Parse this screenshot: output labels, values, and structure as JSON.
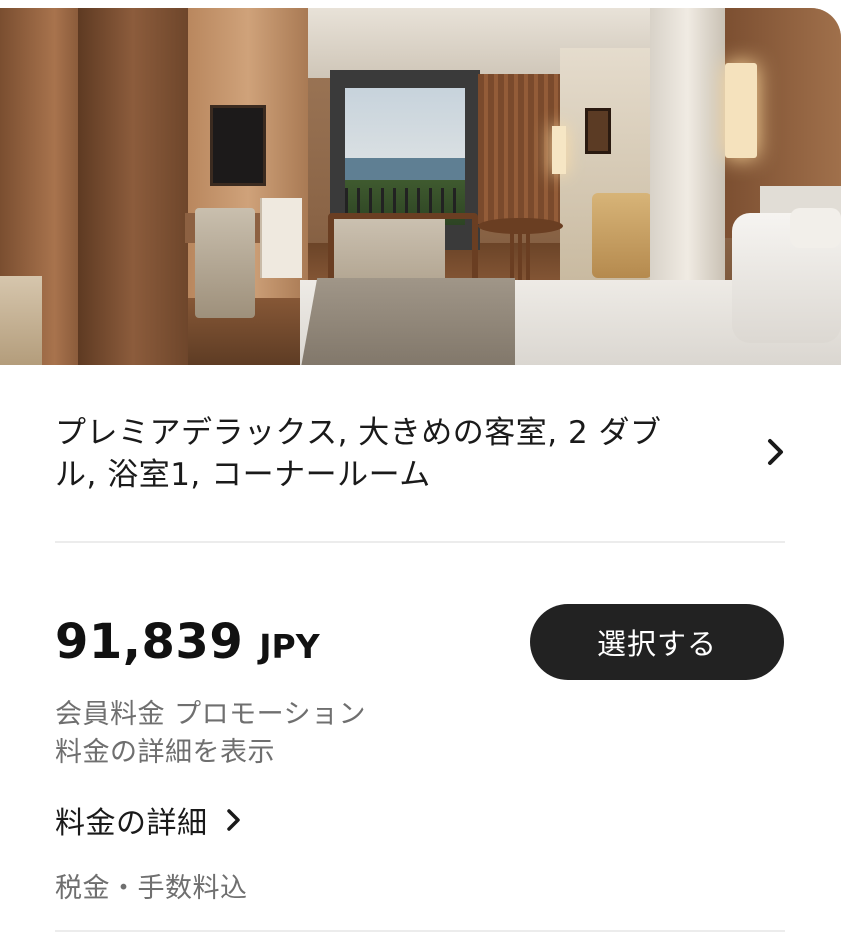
{
  "room": {
    "image_alt": "客室の写真",
    "title": "プレミアデラックス, 大きめの客室, 2 ダブル, 浴室1, コーナールーム",
    "title_chevron_icon": "chevron-right-icon"
  },
  "pricing": {
    "amount": "91,839",
    "currency": "JPY",
    "select_label": "選択する",
    "rate_type": "会員料金 プロモーション",
    "rate_detail_link": "料金の詳細を表示",
    "price_detail_label": "料金の詳細",
    "price_detail_icon": "chevron-right-icon",
    "tax_note": "税金・手数料込"
  },
  "colors": {
    "button_bg": "#222222",
    "button_text": "#ffffff",
    "primary_text": "#1a1a1a",
    "secondary_text": "#6f6f6f",
    "divider": "#ececec"
  }
}
